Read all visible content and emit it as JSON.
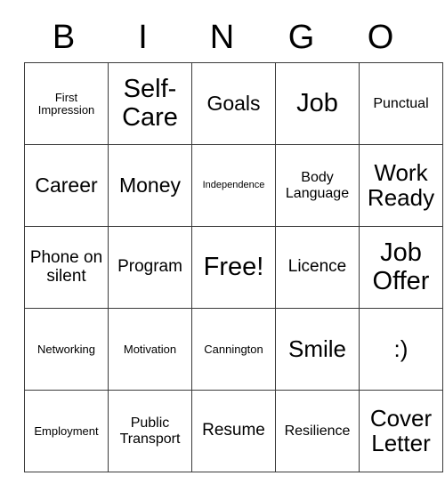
{
  "card": {
    "title": "BINGO",
    "header_letters": [
      "B",
      "I",
      "N",
      "G",
      "O"
    ],
    "grid_size": "5x5",
    "free_space": "Free!",
    "rows": [
      [
        {
          "text": "First Impression",
          "size": "s-xs"
        },
        {
          "text": "Self-Care",
          "size": "s-xxl"
        },
        {
          "text": "Goals",
          "size": "s-lg"
        },
        {
          "text": "Job",
          "size": "s-xxl"
        },
        {
          "text": "Punctual",
          "size": "s-sm"
        }
      ],
      [
        {
          "text": "Career",
          "size": "s-lg"
        },
        {
          "text": "Money",
          "size": "s-lg"
        },
        {
          "text": "Independence",
          "size": "s-xxs"
        },
        {
          "text": "Body Language",
          "size": "s-sm"
        },
        {
          "text": "Work Ready",
          "size": "s-xl"
        }
      ],
      [
        {
          "text": "Phone on silent",
          "size": "s-md"
        },
        {
          "text": "Program",
          "size": "s-md"
        },
        {
          "text": "Free!",
          "size": "s-xxl"
        },
        {
          "text": "Licence",
          "size": "s-md"
        },
        {
          "text": "Job Offer",
          "size": "s-xxl"
        }
      ],
      [
        {
          "text": "Networking",
          "size": "s-xs"
        },
        {
          "text": "Motivation",
          "size": "s-xs"
        },
        {
          "text": "Cannington",
          "size": "s-xs"
        },
        {
          "text": "Smile",
          "size": "s-xl"
        },
        {
          "text": ":)",
          "size": "s-xl"
        }
      ],
      [
        {
          "text": "Employment",
          "size": "s-xs"
        },
        {
          "text": "Public Transport",
          "size": "s-sm"
        },
        {
          "text": "Resume",
          "size": "s-md"
        },
        {
          "text": "Resilience",
          "size": "s-sm"
        },
        {
          "text": "Cover Letter",
          "size": "s-xl"
        }
      ]
    ]
  },
  "colors": {
    "background": "#ffffff",
    "text": "#000000",
    "grid_line": "#3a3a3a"
  }
}
